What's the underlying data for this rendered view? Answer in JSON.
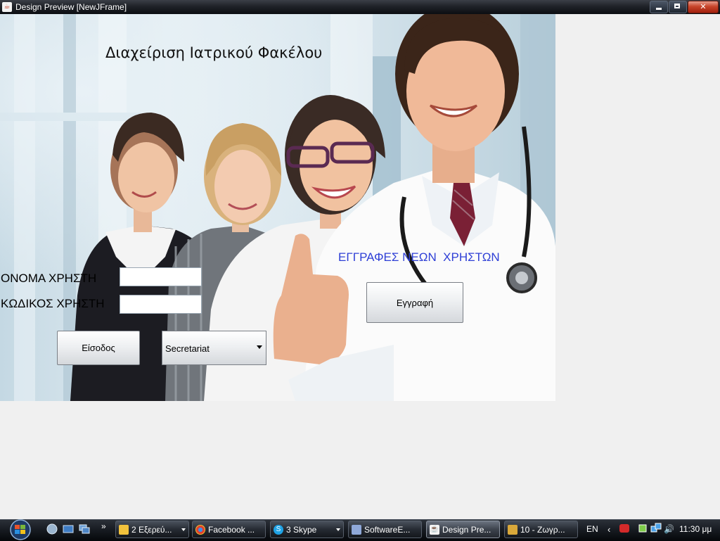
{
  "window": {
    "title": "Design Preview [NewJFrame]",
    "controls": {
      "minimize": "minimize",
      "maximize": "maximize",
      "close": "close"
    }
  },
  "form": {
    "app_title": "Διαχείριση Ιατρικού Φακέλου",
    "username_label": "ΟΝΟΜΑ ΧΡΗΣΤΗ",
    "username_value": "",
    "password_label": "ΚΩΔΙΚΟΣ ΧΡΗΣΤΗ",
    "password_value": "",
    "login_button": "Είσοδος",
    "role_select": {
      "selected": "Secretariat"
    },
    "register_heading": "ΕΓΓΡΑΦΕΣ ΝΕΩΝ  ΧΡΗΣΤΩΝ",
    "register_button": "Εγγραφή"
  },
  "taskbar": {
    "chevron": "»",
    "buttons": [
      {
        "label": "2 Εξερεύ...",
        "icon": "folder-icon",
        "color": "#f2c23c"
      },
      {
        "label": "Facebook ...",
        "icon": "chrome-icon",
        "color": "#e0412f"
      },
      {
        "label": "3 Skype",
        "icon": "skype-icon",
        "color": "#1fa3e6"
      },
      {
        "label": "SoftwareE...",
        "icon": "netbeans-icon",
        "color": "#8fa8d8"
      },
      {
        "label": "Design Pre...",
        "icon": "java-icon",
        "color": "#f3f3f3"
      },
      {
        "label": "10 - Ζωγρ...",
        "icon": "paint-icon",
        "color": "#d9a83a"
      }
    ],
    "language": "EN",
    "clock": "11:30 μμ"
  },
  "colors": {
    "register_heading": "#2e3fd6",
    "titlebar": "#1f2228",
    "background": "#f0f0f0"
  }
}
